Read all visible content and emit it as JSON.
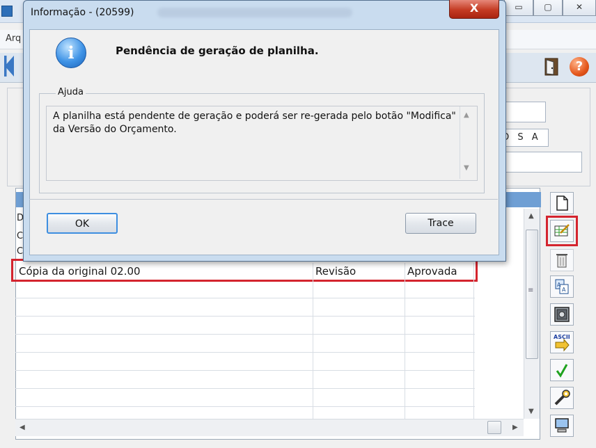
{
  "background_window": {
    "menu_partial": "Arq",
    "field_value": "O S A",
    "grid": {
      "side_letters": [
        "D",
        "C",
        "C"
      ],
      "row": {
        "description": "Cópia da original 02.00",
        "type": "Revisão",
        "status": "Aprovada"
      }
    },
    "tools": [
      "new-document-icon",
      "edit-spreadsheet-icon",
      "delete-icon",
      "copy-icon",
      "vault-icon",
      "ascii-export-icon",
      "check-icon",
      "tools-icon",
      "computer-icon"
    ]
  },
  "dialog": {
    "title": "Informação - (20599)",
    "close_glyph": "X",
    "message": "Pendência de geração de planilha.",
    "help_legend": "Ajuda",
    "help_text": "A planilha está pendente de geração e poderá ser re-gerada pelo botão \"Modifica\" da Versão do Orçamento.",
    "ok_label": "OK",
    "trace_label": "Trace"
  },
  "colors": {
    "highlight": "#d4242e",
    "dialog_frame": "#c9dcef",
    "grid_header": "#6f9fd4"
  }
}
